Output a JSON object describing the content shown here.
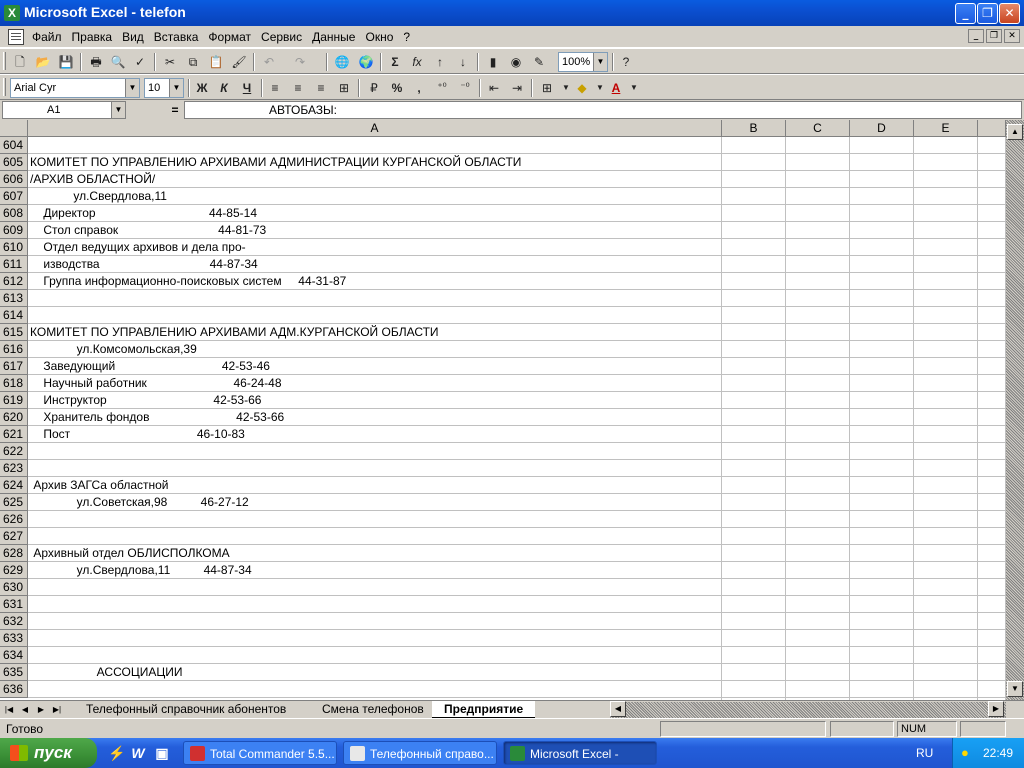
{
  "window": {
    "title": "Microsoft Excel - telefon"
  },
  "menu": [
    "Файл",
    "Правка",
    "Вид",
    "Вставка",
    "Формат",
    "Сервис",
    "Данные",
    "Окно",
    "?"
  ],
  "toolbar": {
    "zoom": "100%",
    "font_name": "Arial Cyr",
    "font_size": "10",
    "bold": "Ж",
    "italic": "К",
    "underline": "Ч",
    "percent": "%",
    "comma": ",",
    "sum": "Σ",
    "fx": "fx"
  },
  "formula_bar": {
    "cell_ref": "A1",
    "equals": "=",
    "content": "АВТОБАЗЫ:"
  },
  "columns": [
    "A",
    "B",
    "C",
    "D",
    "E"
  ],
  "rows": [
    {
      "n": "604",
      "text": ""
    },
    {
      "n": "605",
      "text": "КОМИТЕТ ПО УПРАВЛЕНИЮ АРХИВАМИ АДМИНИСТРАЦИИ КУРГАНСКОЙ ОБЛАСТИ"
    },
    {
      "n": "606",
      "text": "/АРХИВ ОБЛАСТНОЙ/"
    },
    {
      "n": "607",
      "text": "             ул.Свердлова,11"
    },
    {
      "n": "608",
      "text": "    Директор                                  44-85-14"
    },
    {
      "n": "609",
      "text": "    Стол справок                              44-81-73"
    },
    {
      "n": "610",
      "text": "    Отдел ведущих архивов и дела про-"
    },
    {
      "n": "611",
      "text": "    изводства                                 44-87-34"
    },
    {
      "n": "612",
      "text": "    Группа информационно-поисковых систем     44-31-87"
    },
    {
      "n": "613",
      "text": ""
    },
    {
      "n": "614",
      "text": ""
    },
    {
      "n": "615",
      "text": "КОМИТЕТ ПО УПРАВЛЕНИЮ АРХИВАМИ АДМ.КУРГАНСКОЙ ОБЛАСТИ"
    },
    {
      "n": "616",
      "text": "              ул.Комсомольская,39"
    },
    {
      "n": "617",
      "text": "    Заведующий                                42-53-46"
    },
    {
      "n": "618",
      "text": "    Научный работник                          46-24-48"
    },
    {
      "n": "619",
      "text": "    Инструктор                                42-53-66"
    },
    {
      "n": "620",
      "text": "    Хранитель фондов                          42-53-66"
    },
    {
      "n": "621",
      "text": "    Пост                                      46-10-83"
    },
    {
      "n": "622",
      "text": ""
    },
    {
      "n": "623",
      "text": ""
    },
    {
      "n": "624",
      "text": " Архив ЗАГСа областной"
    },
    {
      "n": "625",
      "text": "              ул.Советская,98          46-27-12"
    },
    {
      "n": "626",
      "text": ""
    },
    {
      "n": "627",
      "text": ""
    },
    {
      "n": "628",
      "text": " Архивный отдел ОБЛИСПОЛКОМА"
    },
    {
      "n": "629",
      "text": "              ул.Свердлова,11          44-87-34"
    },
    {
      "n": "630",
      "text": ""
    },
    {
      "n": "631",
      "text": ""
    },
    {
      "n": "632",
      "text": ""
    },
    {
      "n": "633",
      "text": ""
    },
    {
      "n": "634",
      "text": ""
    },
    {
      "n": "635",
      "text": "                    АССОЦИАЦИИ"
    },
    {
      "n": "636",
      "text": ""
    }
  ],
  "sheet_tabs": [
    {
      "label": "Телефонный справочник абонентов",
      "active": false
    },
    {
      "label": "Смена телефонов",
      "active": false
    },
    {
      "label": "Предприятие",
      "active": true
    }
  ],
  "status": {
    "text": "Готово",
    "num": "NUM"
  },
  "taskbar": {
    "start": "пуск",
    "items": [
      {
        "label": "Total Commander 5.5...",
        "active": false
      },
      {
        "label": "Телефонный справо...",
        "active": false
      },
      {
        "label": "Microsoft Excel - telefon",
        "active": true
      }
    ],
    "lang": "RU",
    "clock": "22:49"
  }
}
